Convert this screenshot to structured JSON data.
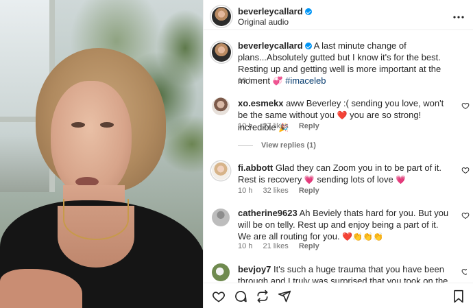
{
  "header": {
    "username": "beverleycallard",
    "subtitle": "Original audio",
    "more_icon": "more-horizontal-icon"
  },
  "caption": {
    "username": "beverleycallard",
    "text": "A last minute change of plans...Absolutely gutted but I know it's for the best. Resting up and getting well is more important at the moment",
    "emoji": "💞",
    "hashtag": "#imaceleb",
    "time": "10 h"
  },
  "comments": [
    {
      "username": "xo.esmekx",
      "text_a": "aww Beverley :( sending you love, won't be the same without you",
      "emoji_a": "❤️",
      "text_b": "you are so strong! incredible",
      "emoji_b": "🎉",
      "time": "10 h",
      "likes": "27 likes",
      "reply": "Reply"
    },
    {
      "username": "fi.abbott",
      "text_a": "Glad they can Zoom you in to be part of it. Rest is recovery",
      "emoji_a": "💗",
      "text_b": "sending lots of love",
      "emoji_b": "💗",
      "time": "10 h",
      "likes": "32 likes",
      "reply": "Reply"
    },
    {
      "username": "catherine9623",
      "text_a": "Ah Beviely thats hard for you. But you will be on telly. Rest up and enjoy being a part of it. We are all routing for you.",
      "emoji_a": "❤️👏👏👏",
      "time": "10 h",
      "likes": "21 likes",
      "reply": "Reply"
    },
    {
      "username": "bevjoy7",
      "text_a": "It's such a huge trauma that you have been through and I truly was surprised that you took on the challenge so"
    }
  ],
  "view_replies": "View replies (1)",
  "footer": {
    "icons": [
      "heart-icon",
      "comment-icon",
      "repost-icon",
      "share-icon",
      "bookmark-icon"
    ]
  },
  "colors": {
    "verified": "#0095f6",
    "hashtag": "#00376b",
    "muted": "#737373",
    "heart_red": "#e3244a"
  }
}
